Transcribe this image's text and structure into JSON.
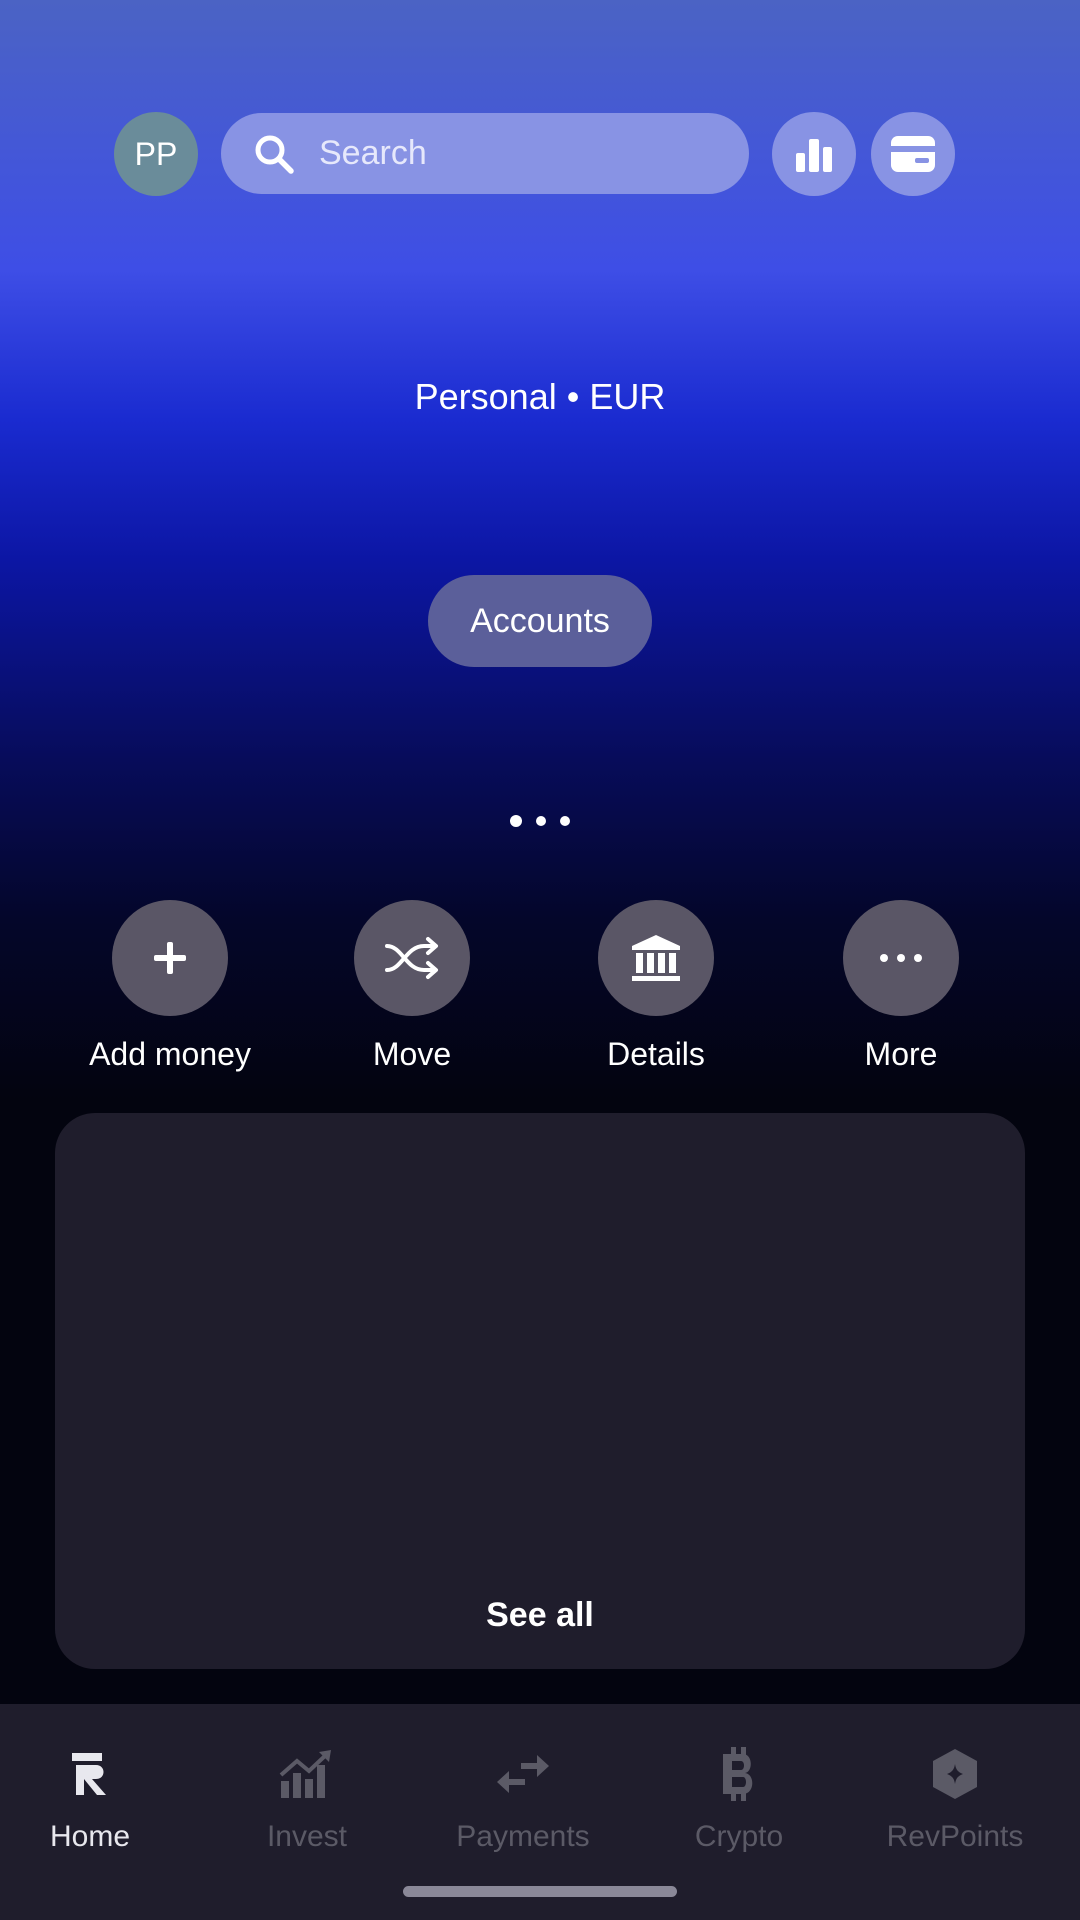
{
  "topbar": {
    "avatar_initials": "PP",
    "search_placeholder": "Search",
    "icons": [
      "search-icon",
      "bar-chart-icon",
      "card-icon"
    ]
  },
  "account": {
    "title": "Personal • EUR",
    "accounts_button": "Accounts"
  },
  "pager": {
    "count": 3,
    "active_index": 0
  },
  "actions": [
    {
      "label": "Add money",
      "icon": "plus-icon"
    },
    {
      "label": "Move",
      "icon": "shuffle-icon"
    },
    {
      "label": "Details",
      "icon": "bank-icon"
    },
    {
      "label": "More",
      "icon": "more-icon"
    }
  ],
  "transactions_card": {
    "see_all_label": "See all"
  },
  "bottom_nav": {
    "items": [
      {
        "label": "Home",
        "icon": "revolut-logo-icon",
        "active": true
      },
      {
        "label": "Invest",
        "icon": "invest-chart-icon",
        "active": false
      },
      {
        "label": "Payments",
        "icon": "payments-arrows-icon",
        "active": false
      },
      {
        "label": "Crypto",
        "icon": "bitcoin-icon",
        "active": false
      },
      {
        "label": "RevPoints",
        "icon": "revpoints-icon",
        "active": false
      }
    ]
  },
  "colors": {
    "accent_button": "#8893e4",
    "action_circle": "#5a5666",
    "card_bg": "#1f1d2c",
    "nav_inactive": "#5b5a66"
  }
}
